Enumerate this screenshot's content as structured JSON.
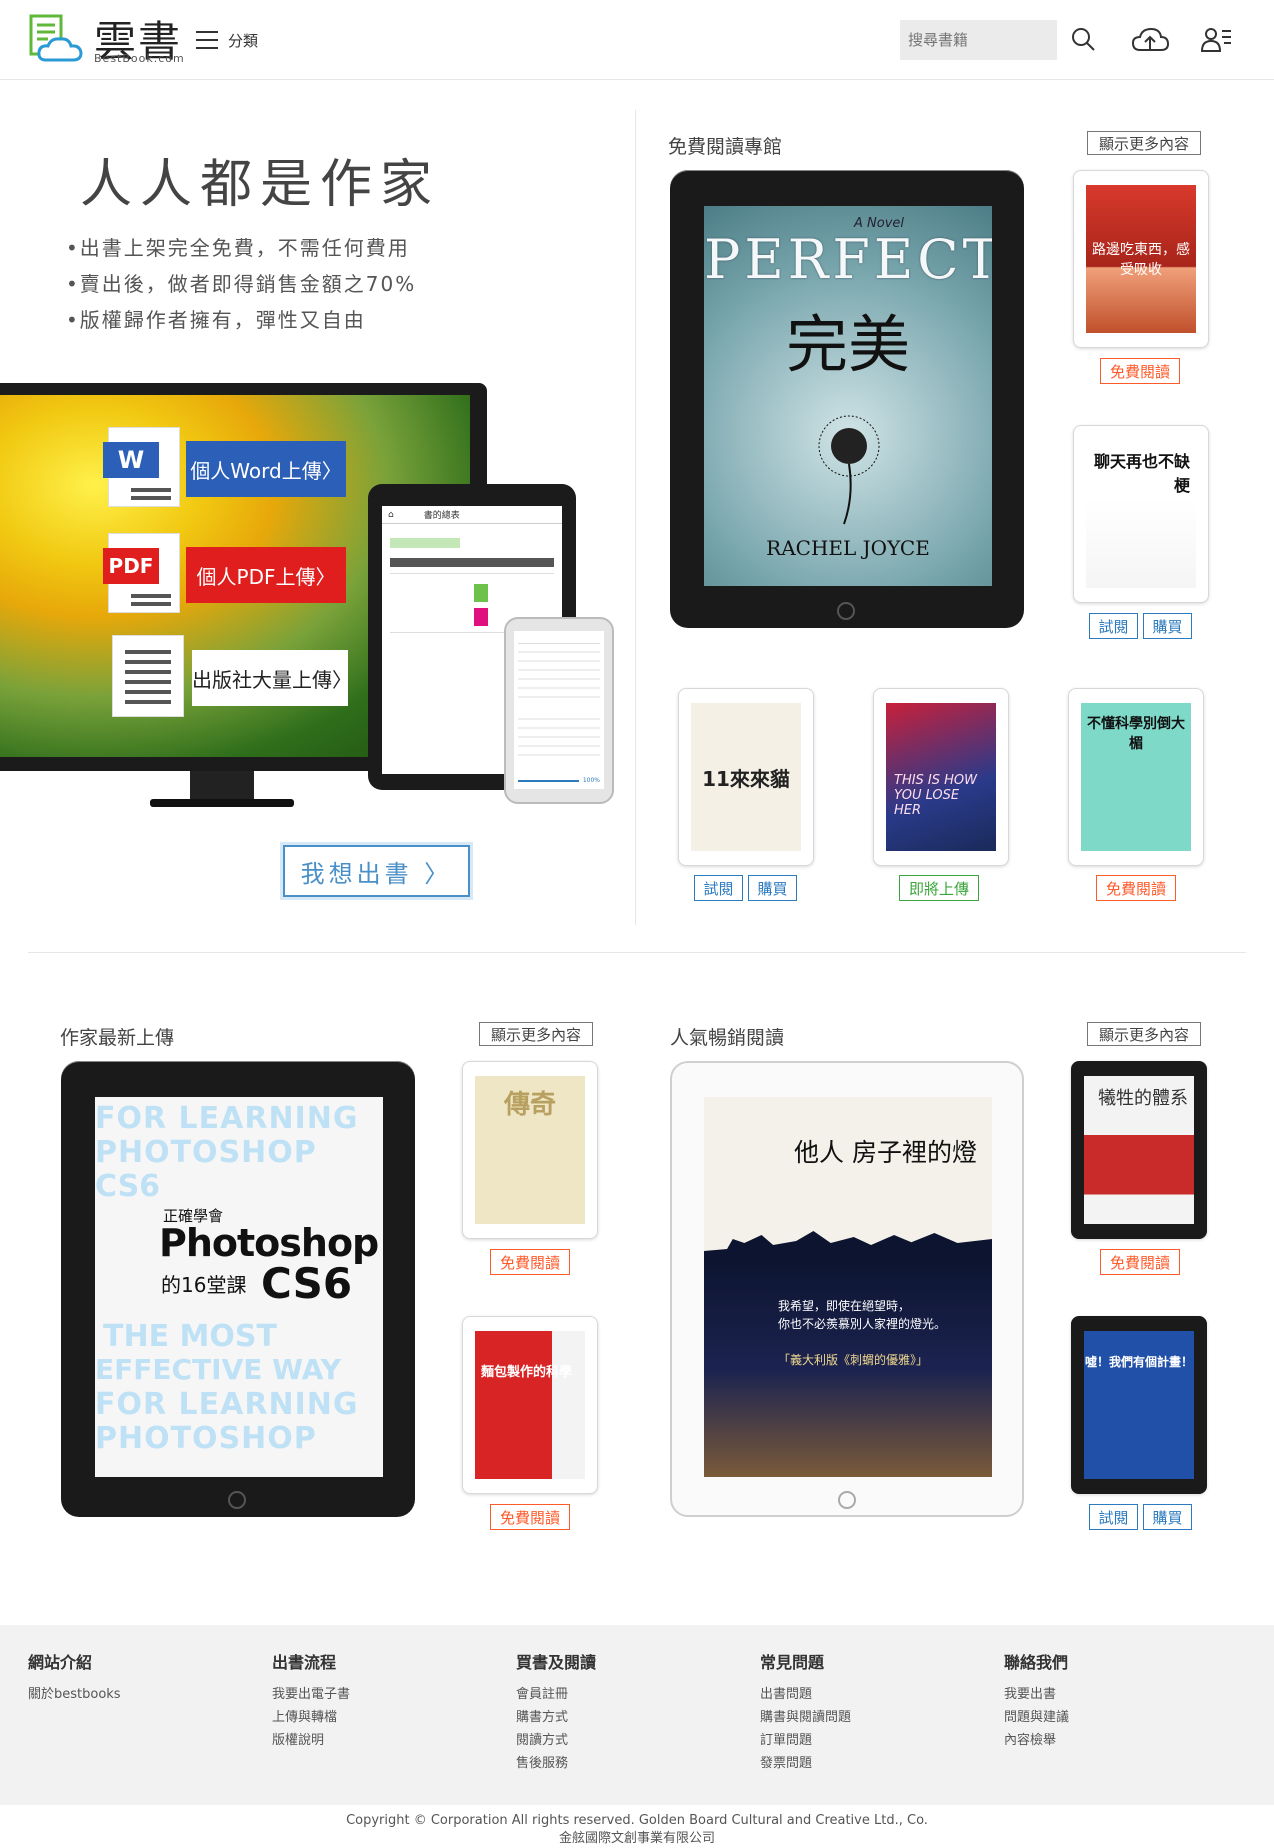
{
  "header": {
    "logo_title": "雲書",
    "logo_sub": "BestBook.com",
    "menu_label": "分類",
    "search_placeholder": "搜尋書籍"
  },
  "hero": {
    "title": "人人都是作家",
    "bullets": [
      "•出書上架完全免費，不需任何費用",
      "•賣出後，做者即得銷售金額之70%",
      "•版權歸作者擁有，彈性又自由"
    ],
    "word_upload": "個人Word上傳〉",
    "pdf_upload": "個人PDF上傳〉",
    "publisher_upload": "出版社大量上傳〉",
    "word_tag": "W",
    "pdf_tag": "PDF",
    "tablet_header": "書的總表",
    "phone_progress": "100%",
    "publish_button": "我想出書 〉"
  },
  "free_section": {
    "title": "免費閱讀專館",
    "more": "顯示更多內容",
    "main_book": {
      "kicker": "A Novel",
      "title_en": "PERFECT",
      "title_zh": "完美",
      "author": "RACHEL JOYCE"
    },
    "books": [
      {
        "cover_text": "路邊吃東西，感受吸收"
      },
      {
        "cover_text": "聊天再也不缺梗"
      },
      {
        "cover_text": "11來來貓"
      },
      {
        "cover_text": "THIS IS HOW YOU LOSE HER"
      },
      {
        "cover_text": "不懂科學別倒大楣"
      }
    ],
    "btn_free": "免費閱讀",
    "btn_try": "試閱",
    "btn_buy": "購買",
    "btn_soon": "即將上傳"
  },
  "new_section": {
    "title": "作家最新上傳",
    "more": "顯示更多內容",
    "main_book": {
      "line1": "FOR LEARNING",
      "line2": "PHOTOSHOP",
      "line3": "CS6",
      "zh": "正確學會",
      "title": "Photoshop",
      "sub": "的16堂課",
      "cs6": "CS6",
      "most": "THE MOST",
      "effective": "EFFECTIVE WAY"
    },
    "books": [
      {
        "cover_text": "傳奇"
      },
      {
        "cover_text": "麵包製作的科學"
      }
    ],
    "btn_free": "免費閱讀"
  },
  "popular_section": {
    "title": "人氣暢銷閱讀",
    "more": "顯示更多內容",
    "main_book": {
      "title": "他人 房子裡的燈",
      "quote1": "我希望，即使在絕望時，",
      "quote2": "你也不必羨慕別人家裡的燈光。",
      "quote3": "「義大利版《刺蝟的優雅》」"
    },
    "books": [
      {
        "cover_text": "犧牲的體系"
      },
      {
        "cover_text": "噓！我們有個計畫！"
      }
    ],
    "btn_free": "免費閱讀",
    "btn_try": "試閱",
    "btn_buy": "購買"
  },
  "footer": {
    "columns": [
      {
        "title": "網站介紹",
        "links": [
          "關於bestbooks"
        ]
      },
      {
        "title": "出書流程",
        "links": [
          "我要出電子書",
          "上傳與轉檔",
          "版權說明"
        ]
      },
      {
        "title": "買書及閱讀",
        "links": [
          "會員註冊",
          "購書方式",
          "閱讀方式",
          "售後服務"
        ]
      },
      {
        "title": "常見問題",
        "links": [
          "出書問題",
          "購書與閱讀問題",
          "訂單問題",
          "發票問題"
        ]
      },
      {
        "title": "聯絡我們",
        "links": [
          "我要出書",
          "問題與建議",
          "內容檢舉"
        ]
      }
    ],
    "copyright_en": "Copyright © Corporation All rights reserved. Golden Board Cultural and Creative Ltd., Co.",
    "copyright_zh": "金舷國際文創事業有限公司"
  },
  "colors": {
    "accent_blue": "#2c7bbf",
    "free_red": "#ff5a2a",
    "soon_green": "#3aa53a",
    "word_blue": "#2b5fb8",
    "pdf_red": "#e01e1e"
  },
  "icons": [
    "logo-icon",
    "menu-icon",
    "search-icon",
    "cloud-upload-icon",
    "user-icon",
    "word-icon",
    "pdf-icon",
    "document-icon",
    "home-icon"
  ]
}
